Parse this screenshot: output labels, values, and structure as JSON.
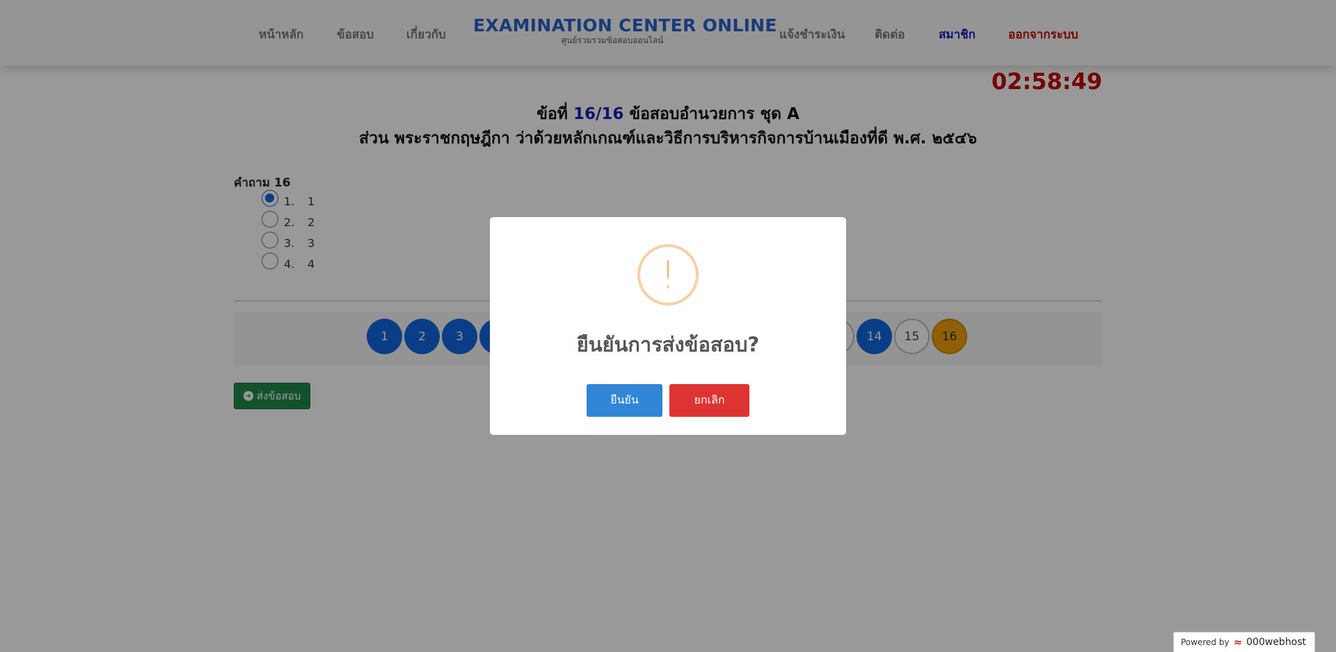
{
  "nav": {
    "home": "หน้าหลัก",
    "exams": "ข้อสอบ",
    "about": "เกี่ยวกับ",
    "brand_title": "EXAMINATION CENTER ONLINE",
    "brand_subtitle": "ศูนย์รวมรวมข้อสอบออนไลน์",
    "payment": "แจ้งชำระเงิน",
    "contact": "ติดต่อ",
    "member": "สมาชิก",
    "logout": "ออกจากระบบ"
  },
  "colors": {
    "member_link": "#1a1ab5",
    "logout_link": "#c40000",
    "answered": "#1266e0",
    "current": "#f0a010",
    "timer": "#c40000"
  },
  "timer": "02:58:49",
  "heading": {
    "prefix": "ข้อที่",
    "progress": "16/16",
    "exam_name": "ข้อสอบอำนวยการ ชุด A",
    "section": "ส่วน พระราชกฤษฎีกา ว่าด้วยหลักเกณฑ์และวิธีการบริหารกิจการบ้านเมืองที่ดี พ.ศ. ๒๕๔๖"
  },
  "question": {
    "label": "คำถาม 16",
    "choices": [
      {
        "num": "1.",
        "text": "1",
        "selected": true
      },
      {
        "num": "2.",
        "text": "2",
        "selected": false
      },
      {
        "num": "3.",
        "text": "3",
        "selected": false
      },
      {
        "num": "4.",
        "text": "4",
        "selected": false
      }
    ]
  },
  "pagination": {
    "visible": [
      {
        "label": "1",
        "state": "answered"
      },
      {
        "label": "2",
        "state": "answered"
      },
      {
        "label": "3",
        "state": "answered"
      },
      {
        "label": "14",
        "state": "answered"
      },
      {
        "label": "15",
        "state": "unanswered"
      },
      {
        "label": "16",
        "state": "current"
      }
    ]
  },
  "submit_button": "ส่งข้อสอบ",
  "modal": {
    "icon": "!",
    "title": "ยืนยันการส่งข้อสอบ?",
    "confirm": "ยืนยัน",
    "cancel": "ยกเลิก"
  },
  "footer": {
    "powered_by": "Powered by",
    "host": "000webhost"
  }
}
